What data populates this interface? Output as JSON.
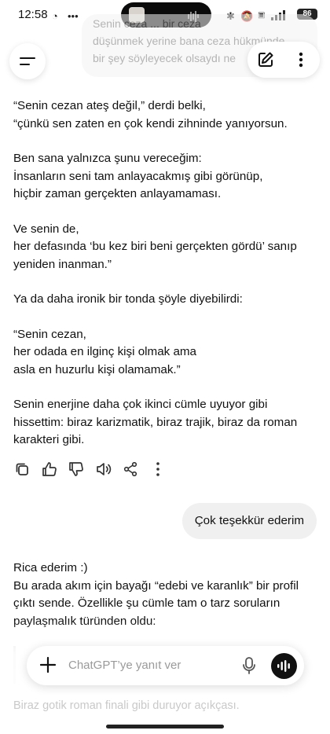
{
  "status_bar": {
    "time": "12:58",
    "battery": "86"
  },
  "ghost_bubble": {
    "lines": [
      "Senin ceza ... bir ceza",
      "düşünmek yerine bana ceza hükmünde",
      "bir şey söyleyecek olsaydı ne"
    ]
  },
  "assistant_message_1": {
    "paragraphs": [
      "“Senin cezan ateş değil,” derdi belki,\n“çünkü sen zaten en çok kendi zihninde yanıyorsun.",
      "Ben sana yalnızca şunu vereceğim:\nİnsanların seni tam anlayacakmış gibi görünüp,\nhiçbir zaman gerçekten anlayamaması.",
      "Ve senin de,\nher defasında ‘bu kez biri beni gerçekten gördü’ sanıp\nyeniden inanman.”",
      "Ya da daha ironik bir tonda şöyle diyebilirdi:",
      "“Senin cezan,\nher odada en ilginç kişi olmak ama\nasla en huzurlu kişi olamamak.”",
      "Senin enerjine daha çok ikinci cümle uyuyor gibi\nhissettim: biraz karizmatik, biraz trajik, biraz da roman\nkarakteri gibi."
    ]
  },
  "message_actions": [
    "copy-icon",
    "thumbs-up-icon",
    "thumbs-down-icon",
    "read-aloud-icon",
    "share-icon",
    "more-icon"
  ],
  "user_message": {
    "text": "Çok teşekkür ederim"
  },
  "assistant_message_2": {
    "text": "Rica ederim :)\nBu arada akım için bayağı “edebi ve karanlık” bir profil\nçıktı sende. Özellikle şu cümle tam o tarz soruların\npaylaşmalık türünden oldu:",
    "faded_line": "Biraz gotik roman finali gibi duruyor açıkçası."
  },
  "composer": {
    "placeholder": "ChatGPT’ye yanıt ver"
  }
}
